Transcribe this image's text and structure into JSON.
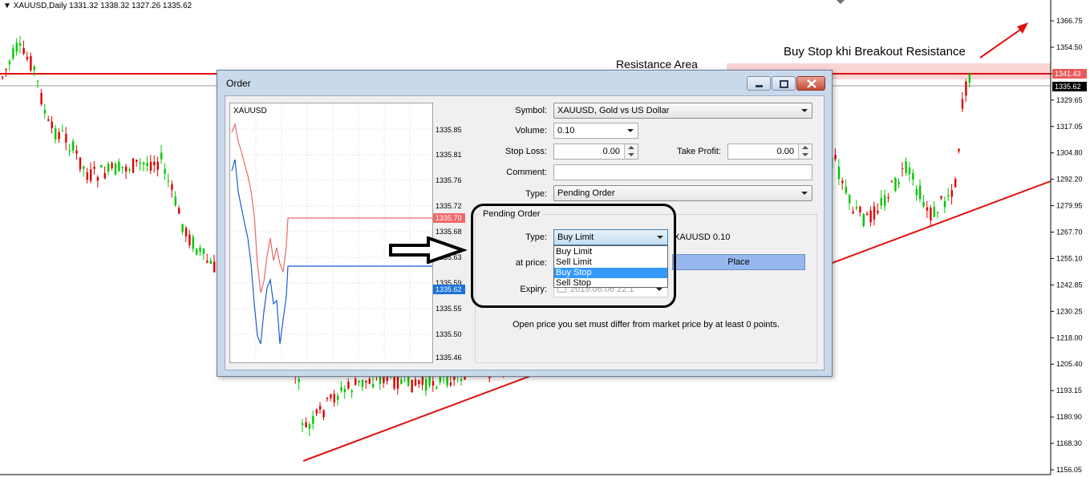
{
  "chart": {
    "header": "XAUUSD,Daily  1331.32 1338.32 1327.26 1335.62",
    "price_axis_ticks": [
      "1366.75",
      "1354.50",
      "1341.43",
      "1329.65",
      "1317.05",
      "1304.80",
      "1292.20",
      "1279.95",
      "1267.70",
      "1255.10",
      "1242.85",
      "1230.25",
      "1218.00",
      "1205.40",
      "1193.15",
      "1180.90",
      "1168.30",
      "1156.05"
    ],
    "resistance_price": "1341.43",
    "current_price": "1335.62",
    "annotation_buy_stop": "Buy Stop khi Breakout Resistance",
    "annotation_resistance": "Resistance Area",
    "colors": {
      "bull": "#00c800",
      "bear": "#e00000",
      "trendline": "#e01010",
      "resistance_zone": "#fbd5d5"
    }
  },
  "dialog": {
    "title": "Order",
    "mini_chart": {
      "symbol": "XAUUSD",
      "ticks": [
        "1335.85",
        "1335.81",
        "1335.76",
        "1335.72",
        "1335.68",
        "1335.63",
        "1335.59",
        "1335.55",
        "1335.50",
        "1335.46"
      ],
      "ask_badge": "1335.70",
      "bid_badge": "1335.62"
    },
    "symbol_label": "Symbol:",
    "symbol_value": "XAUUSD, Gold vs US Dollar",
    "volume_label": "Volume:",
    "volume_value": "0.10",
    "stop_loss_label": "Stop Loss:",
    "stop_loss_value": "0.00",
    "take_profit_label": "Take Profit:",
    "take_profit_value": "0.00",
    "comment_label": "Comment:",
    "comment_value": "",
    "type_label": "Type:",
    "type_value": "Pending Order",
    "pending": {
      "group_title": "Pending Order",
      "type_label": "Type:",
      "type_value": "Buy Limit",
      "options": [
        "Buy Limit",
        "Sell Limit",
        "Buy Stop",
        "Sell Stop"
      ],
      "highlighted_option": "Buy Stop",
      "order_desc": "XAUUSD 0.10",
      "at_price_label": "at price:",
      "expiry_label": "Expiry:",
      "expiry_value": "2019.06.06 22:1",
      "place_button": "Place",
      "info": "Open price you set must differ from market price by at least 0 points."
    }
  }
}
